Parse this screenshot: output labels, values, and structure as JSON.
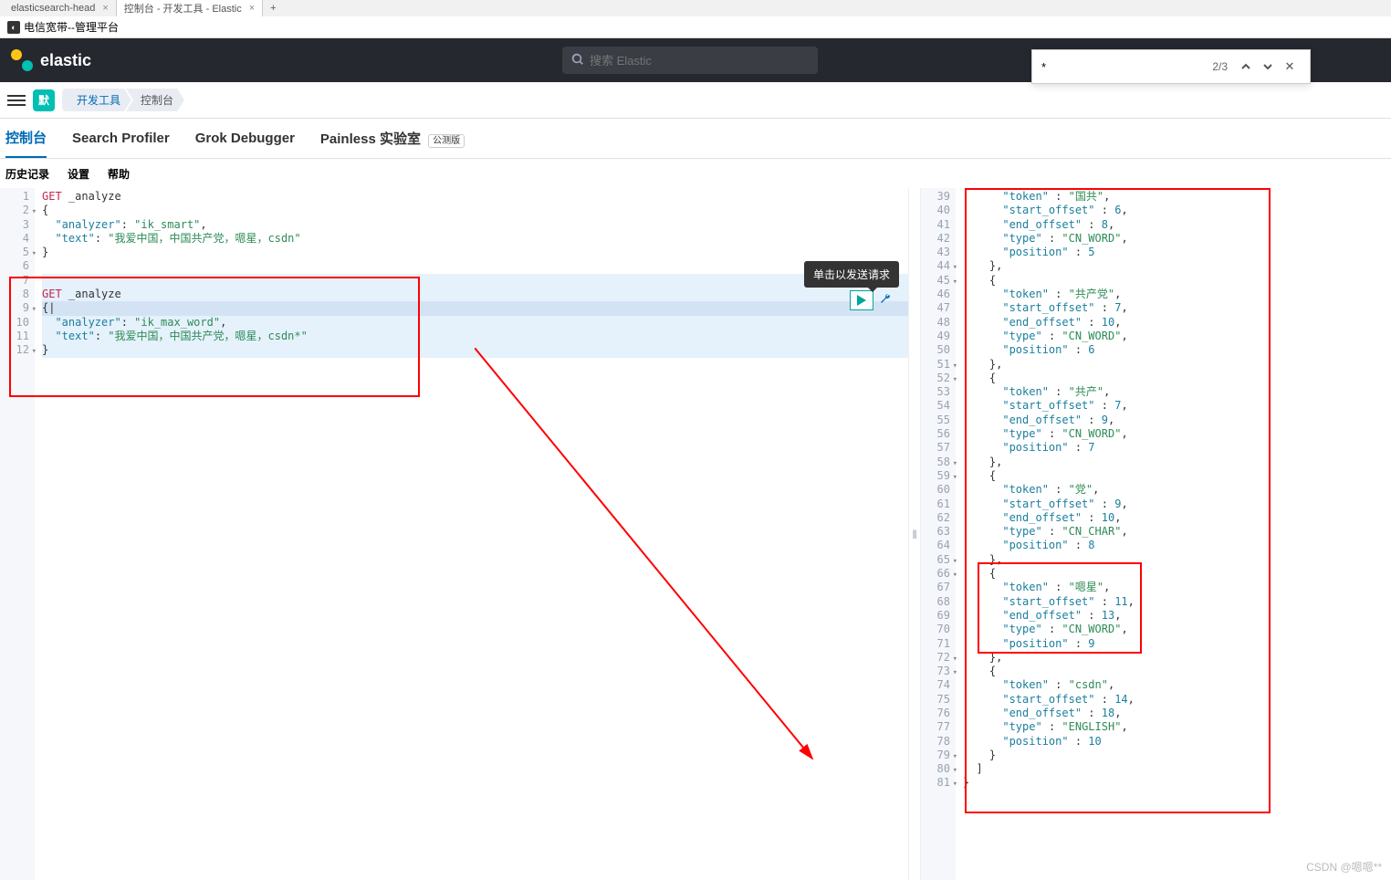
{
  "browser_tabs": [
    {
      "title": "elasticsearch-head",
      "active": false
    },
    {
      "title": "控制台 - 开发工具 - Elastic",
      "active": true
    }
  ],
  "bookmark": {
    "label": "电信宽带--管理平台"
  },
  "header": {
    "brand": "elastic",
    "search_placeholder": "搜索 Elastic"
  },
  "find": {
    "query": "*",
    "count": "2/3"
  },
  "nav": {
    "badge": "默",
    "crumbs": [
      "开发工具",
      "控制台"
    ]
  },
  "subtabs": {
    "items": [
      "控制台",
      "Search Profiler",
      "Grok Debugger",
      "Painless 实验室"
    ],
    "active": 0,
    "beta_label": "公测版"
  },
  "toolbar": {
    "history": "历史记录",
    "settings": "设置",
    "help": "帮助"
  },
  "tooltip": "单击以发送请求",
  "editor_left": {
    "lines": [
      {
        "n": 1,
        "seg": [
          [
            "GET",
            "method"
          ],
          [
            " ",
            "p"
          ],
          [
            "_analyze",
            "p"
          ]
        ]
      },
      {
        "n": 2,
        "fold": true,
        "seg": [
          [
            "{",
            "p"
          ]
        ]
      },
      {
        "n": 3,
        "seg": [
          [
            "  ",
            "p"
          ],
          [
            "\"analyzer\"",
            "key"
          ],
          [
            ": ",
            "p"
          ],
          [
            "\"ik_smart\"",
            "str"
          ],
          [
            ",",
            "p"
          ]
        ]
      },
      {
        "n": 4,
        "seg": [
          [
            "  ",
            "p"
          ],
          [
            "\"text\"",
            "key"
          ],
          [
            ": ",
            "p"
          ],
          [
            "\"我爱中国，中国共产党，嗯星，csdn\"",
            "str"
          ]
        ]
      },
      {
        "n": 5,
        "fold": true,
        "seg": [
          [
            "}",
            "p"
          ]
        ]
      },
      {
        "n": 6,
        "seg": []
      },
      {
        "n": 7,
        "seg": [],
        "hl": true
      },
      {
        "n": 8,
        "seg": [
          [
            "GET",
            "method"
          ],
          [
            " ",
            "p"
          ],
          [
            "_analyze",
            "p"
          ]
        ],
        "hl": true
      },
      {
        "n": 9,
        "fold": true,
        "seg": [
          [
            "{",
            "p"
          ],
          [
            "|",
            "p"
          ]
        ],
        "sel": true
      },
      {
        "n": 10,
        "seg": [
          [
            "  ",
            "p"
          ],
          [
            "\"analyzer\"",
            "key"
          ],
          [
            ": ",
            "p"
          ],
          [
            "\"ik_max_word\"",
            "str"
          ],
          [
            ",",
            "p"
          ]
        ],
        "hl": true
      },
      {
        "n": 11,
        "seg": [
          [
            "  ",
            "p"
          ],
          [
            "\"text\"",
            "key"
          ],
          [
            ": ",
            "p"
          ],
          [
            "\"我爱中国，中国共产党，嗯星，csdn*\"",
            "str"
          ]
        ],
        "hl": true
      },
      {
        "n": 12,
        "fold": true,
        "seg": [
          [
            "}",
            "p"
          ]
        ],
        "hl": true
      }
    ]
  },
  "editor_right": {
    "lines": [
      {
        "n": 39,
        "seg": [
          [
            "      ",
            "p"
          ],
          [
            "\"token\"",
            "key"
          ],
          [
            " : ",
            "p"
          ],
          [
            "\"国共\"",
            "str"
          ],
          [
            ",",
            "p"
          ]
        ]
      },
      {
        "n": 40,
        "seg": [
          [
            "      ",
            "p"
          ],
          [
            "\"start_offset\"",
            "key"
          ],
          [
            " : ",
            "p"
          ],
          [
            "6",
            "num"
          ],
          [
            ",",
            "p"
          ]
        ]
      },
      {
        "n": 41,
        "seg": [
          [
            "      ",
            "p"
          ],
          [
            "\"end_offset\"",
            "key"
          ],
          [
            " : ",
            "p"
          ],
          [
            "8",
            "num"
          ],
          [
            ",",
            "p"
          ]
        ]
      },
      {
        "n": 42,
        "seg": [
          [
            "      ",
            "p"
          ],
          [
            "\"type\"",
            "key"
          ],
          [
            " : ",
            "p"
          ],
          [
            "\"CN_WORD\"",
            "str"
          ],
          [
            ",",
            "p"
          ]
        ]
      },
      {
        "n": 43,
        "seg": [
          [
            "      ",
            "p"
          ],
          [
            "\"position\"",
            "key"
          ],
          [
            " : ",
            "p"
          ],
          [
            "5",
            "num"
          ]
        ]
      },
      {
        "n": 44,
        "fold": true,
        "seg": [
          [
            "    },",
            "p"
          ]
        ]
      },
      {
        "n": 45,
        "fold": true,
        "seg": [
          [
            "    {",
            "p"
          ]
        ]
      },
      {
        "n": 46,
        "seg": [
          [
            "      ",
            "p"
          ],
          [
            "\"token\"",
            "key"
          ],
          [
            " : ",
            "p"
          ],
          [
            "\"共产党\"",
            "str"
          ],
          [
            ",",
            "p"
          ]
        ]
      },
      {
        "n": 47,
        "seg": [
          [
            "      ",
            "p"
          ],
          [
            "\"start_offset\"",
            "key"
          ],
          [
            " : ",
            "p"
          ],
          [
            "7",
            "num"
          ],
          [
            ",",
            "p"
          ]
        ]
      },
      {
        "n": 48,
        "seg": [
          [
            "      ",
            "p"
          ],
          [
            "\"end_offset\"",
            "key"
          ],
          [
            " : ",
            "p"
          ],
          [
            "10",
            "num"
          ],
          [
            ",",
            "p"
          ]
        ]
      },
      {
        "n": 49,
        "seg": [
          [
            "      ",
            "p"
          ],
          [
            "\"type\"",
            "key"
          ],
          [
            " : ",
            "p"
          ],
          [
            "\"CN_WORD\"",
            "str"
          ],
          [
            ",",
            "p"
          ]
        ]
      },
      {
        "n": 50,
        "seg": [
          [
            "      ",
            "p"
          ],
          [
            "\"position\"",
            "key"
          ],
          [
            " : ",
            "p"
          ],
          [
            "6",
            "num"
          ]
        ]
      },
      {
        "n": 51,
        "fold": true,
        "seg": [
          [
            "    },",
            "p"
          ]
        ]
      },
      {
        "n": 52,
        "fold": true,
        "seg": [
          [
            "    {",
            "p"
          ]
        ]
      },
      {
        "n": 53,
        "seg": [
          [
            "      ",
            "p"
          ],
          [
            "\"token\"",
            "key"
          ],
          [
            " : ",
            "p"
          ],
          [
            "\"共产\"",
            "str"
          ],
          [
            ",",
            "p"
          ]
        ]
      },
      {
        "n": 54,
        "seg": [
          [
            "      ",
            "p"
          ],
          [
            "\"start_offset\"",
            "key"
          ],
          [
            " : ",
            "p"
          ],
          [
            "7",
            "num"
          ],
          [
            ",",
            "p"
          ]
        ]
      },
      {
        "n": 55,
        "seg": [
          [
            "      ",
            "p"
          ],
          [
            "\"end_offset\"",
            "key"
          ],
          [
            " : ",
            "p"
          ],
          [
            "9",
            "num"
          ],
          [
            ",",
            "p"
          ]
        ]
      },
      {
        "n": 56,
        "seg": [
          [
            "      ",
            "p"
          ],
          [
            "\"type\"",
            "key"
          ],
          [
            " : ",
            "p"
          ],
          [
            "\"CN_WORD\"",
            "str"
          ],
          [
            ",",
            "p"
          ]
        ]
      },
      {
        "n": 57,
        "seg": [
          [
            "      ",
            "p"
          ],
          [
            "\"position\"",
            "key"
          ],
          [
            " : ",
            "p"
          ],
          [
            "7",
            "num"
          ]
        ]
      },
      {
        "n": 58,
        "fold": true,
        "seg": [
          [
            "    },",
            "p"
          ]
        ]
      },
      {
        "n": 59,
        "fold": true,
        "seg": [
          [
            "    {",
            "p"
          ]
        ]
      },
      {
        "n": 60,
        "seg": [
          [
            "      ",
            "p"
          ],
          [
            "\"token\"",
            "key"
          ],
          [
            " : ",
            "p"
          ],
          [
            "\"党\"",
            "str"
          ],
          [
            ",",
            "p"
          ]
        ]
      },
      {
        "n": 61,
        "seg": [
          [
            "      ",
            "p"
          ],
          [
            "\"start_offset\"",
            "key"
          ],
          [
            " : ",
            "p"
          ],
          [
            "9",
            "num"
          ],
          [
            ",",
            "p"
          ]
        ]
      },
      {
        "n": 62,
        "seg": [
          [
            "      ",
            "p"
          ],
          [
            "\"end_offset\"",
            "key"
          ],
          [
            " : ",
            "p"
          ],
          [
            "10",
            "num"
          ],
          [
            ",",
            "p"
          ]
        ]
      },
      {
        "n": 63,
        "seg": [
          [
            "      ",
            "p"
          ],
          [
            "\"type\"",
            "key"
          ],
          [
            " : ",
            "p"
          ],
          [
            "\"CN_CHAR\"",
            "str"
          ],
          [
            ",",
            "p"
          ]
        ]
      },
      {
        "n": 64,
        "seg": [
          [
            "      ",
            "p"
          ],
          [
            "\"position\"",
            "key"
          ],
          [
            " : ",
            "p"
          ],
          [
            "8",
            "num"
          ]
        ]
      },
      {
        "n": 65,
        "fold": true,
        "seg": [
          [
            "    },",
            "p"
          ]
        ]
      },
      {
        "n": 66,
        "fold": true,
        "seg": [
          [
            "    {",
            "p"
          ]
        ]
      },
      {
        "n": 67,
        "seg": [
          [
            "      ",
            "p"
          ],
          [
            "\"token\"",
            "key"
          ],
          [
            " : ",
            "p"
          ],
          [
            "\"嗯星\"",
            "str"
          ],
          [
            ",",
            "p"
          ]
        ]
      },
      {
        "n": 68,
        "seg": [
          [
            "      ",
            "p"
          ],
          [
            "\"start_offset\"",
            "key"
          ],
          [
            " : ",
            "p"
          ],
          [
            "11",
            "num"
          ],
          [
            ",",
            "p"
          ]
        ]
      },
      {
        "n": 69,
        "seg": [
          [
            "      ",
            "p"
          ],
          [
            "\"end_offset\"",
            "key"
          ],
          [
            " : ",
            "p"
          ],
          [
            "13",
            "num"
          ],
          [
            ",",
            "p"
          ]
        ]
      },
      {
        "n": 70,
        "seg": [
          [
            "      ",
            "p"
          ],
          [
            "\"type\"",
            "key"
          ],
          [
            " : ",
            "p"
          ],
          [
            "\"CN_WORD\"",
            "str"
          ],
          [
            ",",
            "p"
          ]
        ]
      },
      {
        "n": 71,
        "seg": [
          [
            "      ",
            "p"
          ],
          [
            "\"position\"",
            "key"
          ],
          [
            " : ",
            "p"
          ],
          [
            "9",
            "num"
          ]
        ]
      },
      {
        "n": 72,
        "fold": true,
        "seg": [
          [
            "    },",
            "p"
          ]
        ]
      },
      {
        "n": 73,
        "fold": true,
        "seg": [
          [
            "    {",
            "p"
          ]
        ]
      },
      {
        "n": 74,
        "seg": [
          [
            "      ",
            "p"
          ],
          [
            "\"token\"",
            "key"
          ],
          [
            " : ",
            "p"
          ],
          [
            "\"csdn\"",
            "str"
          ],
          [
            ",",
            "p"
          ]
        ]
      },
      {
        "n": 75,
        "seg": [
          [
            "      ",
            "p"
          ],
          [
            "\"start_offset\"",
            "key"
          ],
          [
            " : ",
            "p"
          ],
          [
            "14",
            "num"
          ],
          [
            ",",
            "p"
          ]
        ]
      },
      {
        "n": 76,
        "seg": [
          [
            "      ",
            "p"
          ],
          [
            "\"end_offset\"",
            "key"
          ],
          [
            " : ",
            "p"
          ],
          [
            "18",
            "num"
          ],
          [
            ",",
            "p"
          ]
        ]
      },
      {
        "n": 77,
        "seg": [
          [
            "      ",
            "p"
          ],
          [
            "\"type\"",
            "key"
          ],
          [
            " : ",
            "p"
          ],
          [
            "\"ENGLISH\"",
            "str"
          ],
          [
            ",",
            "p"
          ]
        ]
      },
      {
        "n": 78,
        "seg": [
          [
            "      ",
            "p"
          ],
          [
            "\"position\"",
            "key"
          ],
          [
            " : ",
            "p"
          ],
          [
            "10",
            "num"
          ]
        ]
      },
      {
        "n": 79,
        "fold": true,
        "seg": [
          [
            "    }",
            "p"
          ]
        ]
      },
      {
        "n": 80,
        "fold": true,
        "seg": [
          [
            "  ]",
            "p"
          ]
        ]
      },
      {
        "n": 81,
        "fold": true,
        "seg": [
          [
            "}",
            "p"
          ]
        ]
      }
    ]
  },
  "watermark": "CSDN @嗯嗯**"
}
